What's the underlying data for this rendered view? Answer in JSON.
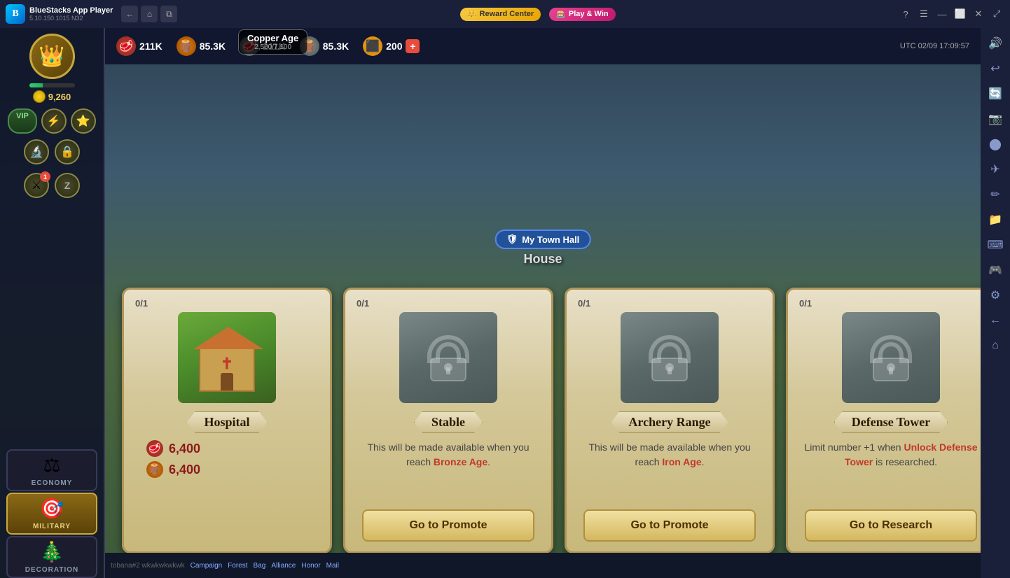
{
  "app": {
    "title": "BlueStacks App Player",
    "version": "5.10.150.1015  N32",
    "logo_letter": "B"
  },
  "topbar": {
    "nav_back": "←",
    "nav_home": "⌂",
    "nav_windows": "⧉",
    "reward_center": "Reward Center",
    "play_win": "Play & Win",
    "utc_time": "UTC  02/09  17:09:57",
    "controls": [
      "?",
      "☰",
      "—",
      "⬜",
      "✕",
      "⤢"
    ]
  },
  "resources": {
    "meat_value": "211K",
    "wood_value": "85.3K",
    "stone_value": "211K",
    "ore_value": "85.3K",
    "gold_value": "200",
    "gold_plus": "+"
  },
  "age": {
    "name": "Copper Age",
    "progress": "2,500/7,100"
  },
  "sidebar": {
    "coin_count": "9,260",
    "vip_label": "VIP",
    "economy_label": "ECONOMY",
    "military_label": "MILITARY",
    "decoration_label": "DECORATION"
  },
  "game": {
    "building_type": "House",
    "town_hall_label": "My Town Hall"
  },
  "cards": [
    {
      "id": "hospital",
      "counter": "0/1",
      "name": "Hospital",
      "image_type": "hospital",
      "cost_meat": "6,400",
      "cost_wood": "6,400",
      "description": "",
      "has_button": false
    },
    {
      "id": "stable",
      "counter": "0/1",
      "name": "Stable",
      "image_type": "locked",
      "cost_meat": "",
      "cost_wood": "",
      "description_prefix": "This will be made available when you reach ",
      "description_highlight": "Bronze Age",
      "description_suffix": ".",
      "action_label": "Go to Promote",
      "has_button": true
    },
    {
      "id": "archery_range",
      "counter": "0/1",
      "name": "Archery Range",
      "image_type": "locked",
      "description_prefix": "This will be made available when you reach ",
      "description_highlight": "Iron Age",
      "description_suffix": ".",
      "action_label": "Go to Promote",
      "has_button": true
    },
    {
      "id": "defense_tower",
      "counter": "0/1",
      "name": "Defense Tower",
      "image_type": "locked_tower",
      "description_prefix": "Limit number +1 when ",
      "description_highlight": "Unlock Defense Tower",
      "description_suffix": " is researched.",
      "action_label": "Go to Research",
      "has_button": true
    }
  ],
  "right_toolbar": {
    "icons": [
      "🔊",
      "⚡",
      "↩",
      "🔄",
      "📷",
      "⬤",
      "✈",
      "✏",
      "📁",
      "⌨",
      "🎮",
      "⚙",
      "←",
      "⌂"
    ]
  },
  "bottom_bar": {
    "items": [
      "tobana#2  wkwkwkwkwk",
      "Campaign",
      "Forest",
      "Bag",
      "Alliance",
      "Honor",
      "Mail"
    ]
  }
}
